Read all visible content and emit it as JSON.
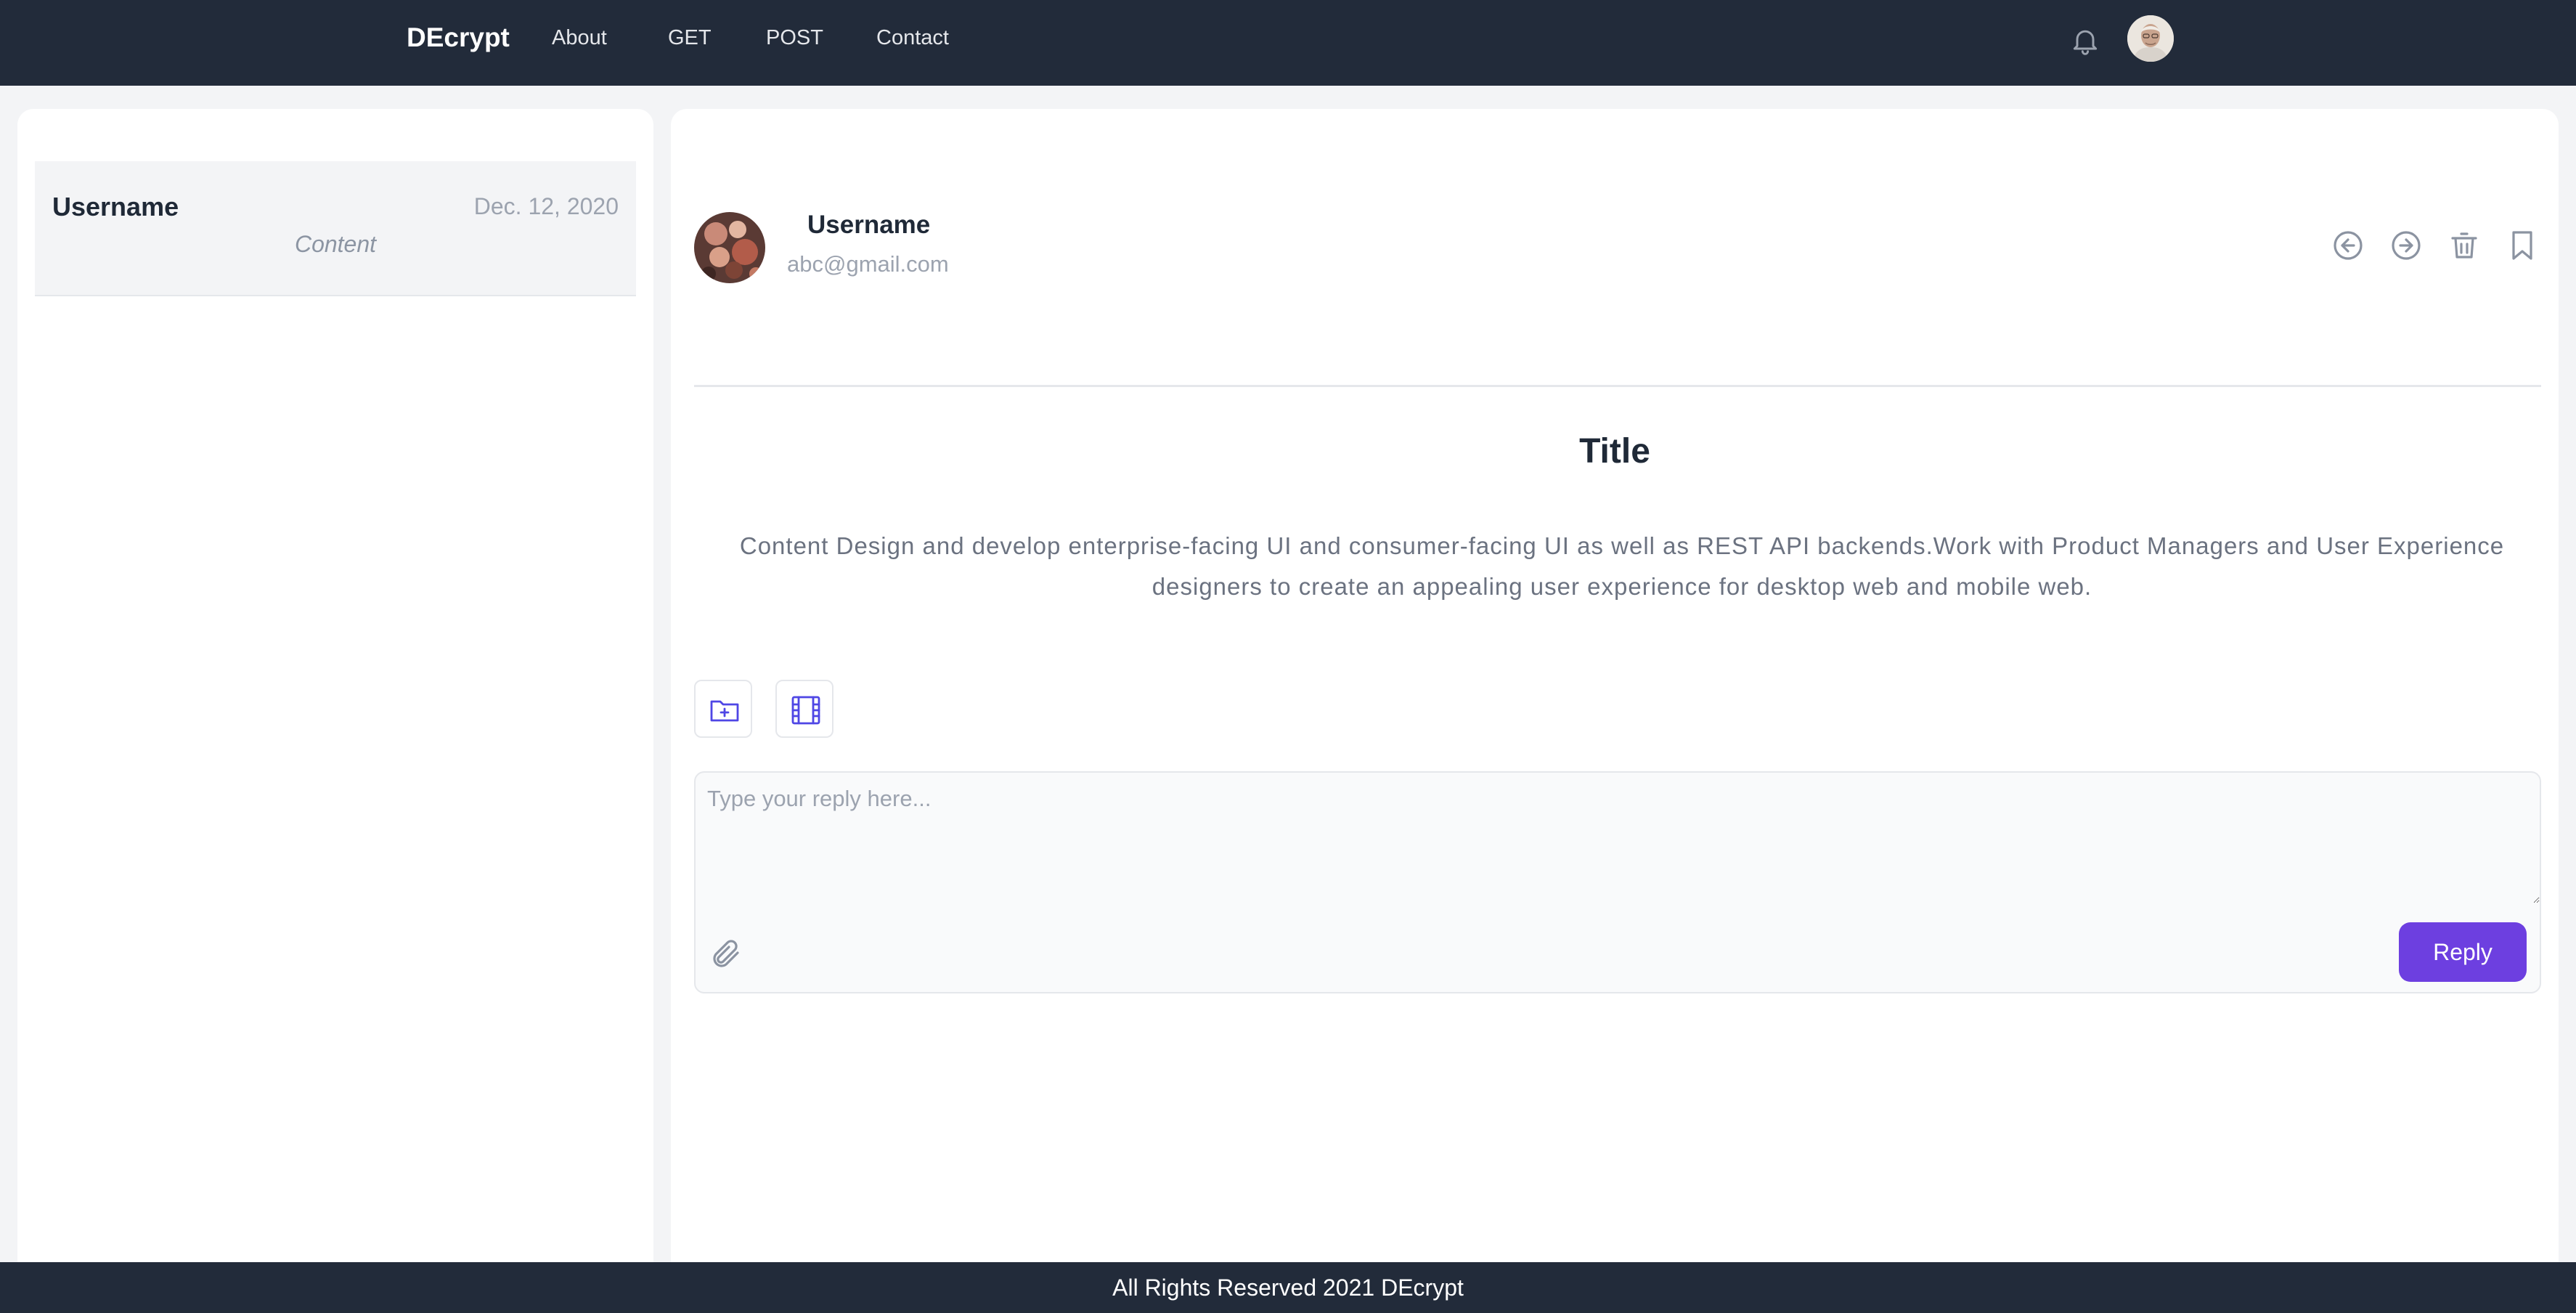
{
  "nav": {
    "brand": "DEcrypt",
    "links": [
      "About",
      "GET",
      "POST",
      "Contact"
    ]
  },
  "inbox": {
    "items": [
      {
        "username": "Username",
        "date": "Dec. 12, 2020",
        "content": "Content"
      }
    ]
  },
  "message": {
    "sender_name": "Username",
    "sender_email": "abc@gmail.com",
    "title": "Title",
    "body": "Content Design and develop enterprise-facing UI and consumer-facing UI as well as REST API backends.Work with Product Managers and User Experience designers to create an appealing user experience for desktop web and mobile web."
  },
  "reply": {
    "placeholder": "Type your reply here...",
    "button_label": "Reply"
  },
  "footer": {
    "text": "All Rights Reserved 2021 DEcrypt"
  },
  "colors": {
    "nav_bg": "#222b3a",
    "page_bg": "#f3f4f6",
    "accent": "#6d3fe0",
    "tool_icon": "#4f46e5"
  }
}
